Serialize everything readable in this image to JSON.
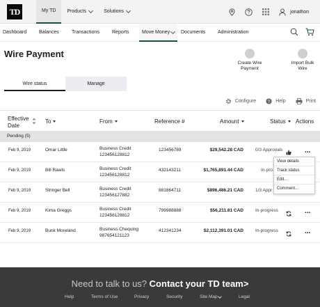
{
  "topbar": {
    "logo_text": "TD",
    "nav": [
      {
        "label": "My TD",
        "active": true
      },
      {
        "label": "Products",
        "has_dropdown": true
      },
      {
        "label": "Solutions",
        "has_dropdown": true
      }
    ],
    "icons": [
      "location-icon",
      "help-icon",
      "apps-grid-icon",
      "user-icon"
    ],
    "username": "jonathon"
  },
  "subnav": {
    "items": [
      {
        "label": "Dashboard"
      },
      {
        "label": "Balances"
      },
      {
        "label": "Transactions"
      },
      {
        "label": "Reports"
      },
      {
        "label": "Move Money",
        "active": true,
        "has_dropdown": true
      },
      {
        "label": "Documents"
      },
      {
        "label": "Administration"
      }
    ],
    "icons": [
      "search-icon",
      "cart-icon"
    ]
  },
  "page": {
    "title": "Wire Payment",
    "actions": [
      {
        "label_line1": "Create Wire",
        "label_line2": "Payment"
      },
      {
        "label_line1": "Import Bulk",
        "label_line2": "Wire"
      }
    ]
  },
  "tabs": [
    {
      "label": "Wire status",
      "active": true
    },
    {
      "label": "Manage",
      "active": false
    }
  ],
  "tools": {
    "configure": "Configure",
    "help": "Help",
    "print": "Print"
  },
  "table": {
    "headers": {
      "effective_date_line1": "Effective",
      "effective_date_line2": "Date",
      "to": "To",
      "from": "From",
      "reference": "Reference #",
      "amount": "Amount",
      "status": "Status",
      "actions": "Actions"
    },
    "group_label": "Pending (5)",
    "rows": [
      {
        "date": "Feb 9, 2019",
        "to": "Omar Little",
        "from_line1": "Business Credit",
        "from_line2": "123456128812",
        "reference": "123456789",
        "amount": "$29,542.28 CAD",
        "status": "0/3 Approvals",
        "status_icon": "thumbs-up-icon"
      },
      {
        "date": "Feb 9, 2019",
        "to": "Bill Rawls",
        "from_line1": "Business Credit",
        "from_line2": "123456128812",
        "reference": "432143211",
        "amount": "$1,765,891.44 CAD",
        "status": "In-pro",
        "status_icon": ""
      },
      {
        "date": "Feb 9, 2019",
        "to": "Stringer Bell",
        "from_line1": "Business Credit",
        "from_line2": "123456127882",
        "reference": "881864711",
        "amount": "$896,486.21 CAD",
        "status": "1/3 Appr",
        "status_icon": ""
      },
      {
        "date": "Feb 9, 2019",
        "to": "Kima Greggs",
        "from_line1": "Business Credit",
        "from_line2": "123456128812",
        "reference": "799988888",
        "amount": "$56,211.81 CAD",
        "status": "In-progress",
        "status_icon": "refresh-icon"
      },
      {
        "date": "Feb 9, 2019",
        "to": "Bunk Moreland",
        "from_line1": "Business Chequing",
        "from_line2": "987654121123",
        "reference": "412341234",
        "amount": "$2,112,391.01 CAD",
        "status": "In-progress",
        "status_icon": "refresh-icon"
      }
    ],
    "row_menu": [
      "View details",
      "Track status",
      "Edit...",
      "Comment..."
    ]
  },
  "footer": {
    "cta_light": "Need to talk to us?",
    "cta_bold": "Contact your TD team>",
    "links": [
      "Help",
      "Terms of Use",
      "Privacy",
      "Security",
      "Site Map",
      "Legal"
    ]
  },
  "colors": {
    "brand_green": "#1a5336",
    "footer_bg": "#3a3a3a",
    "group_bg": "#e4e4e4",
    "inactive_tab_bg": "#ececf2"
  }
}
